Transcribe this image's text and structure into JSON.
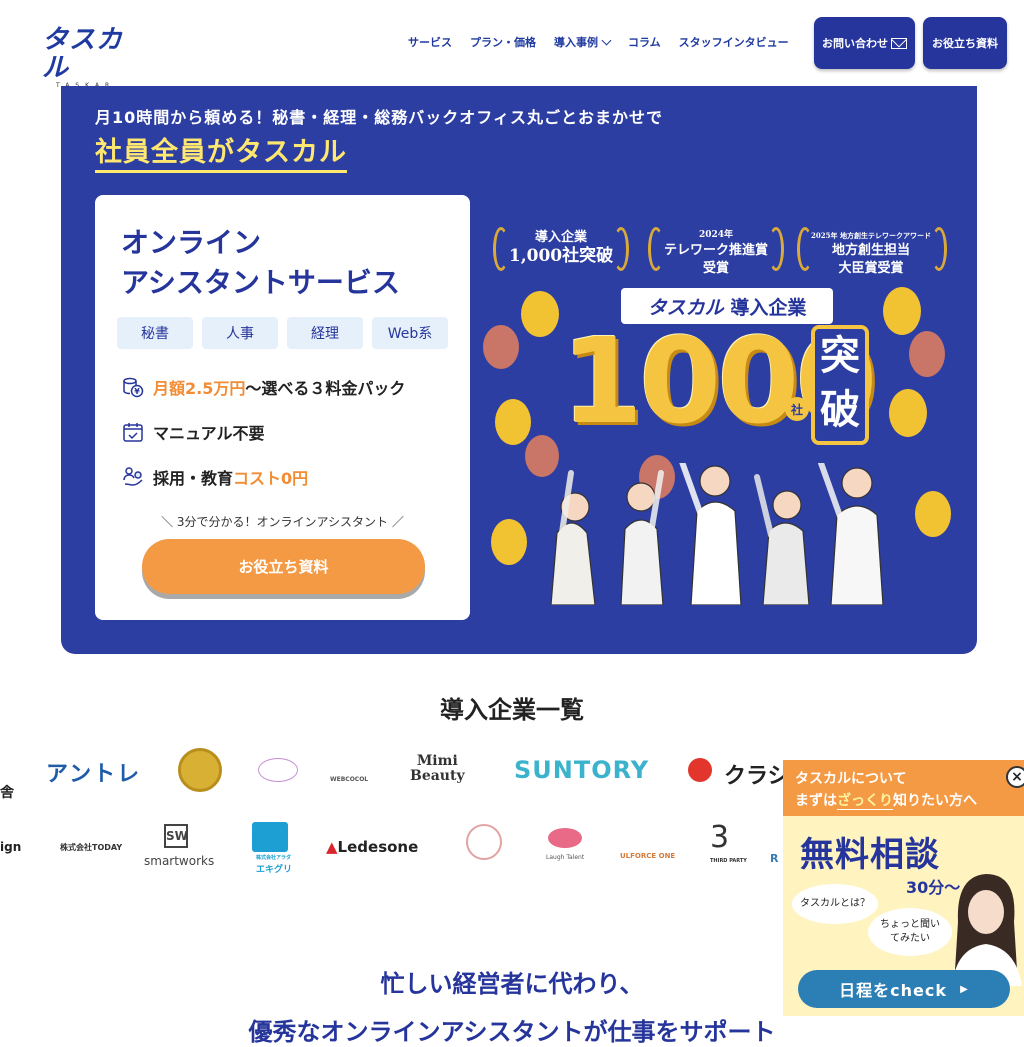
{
  "header": {
    "logo": "タスカル",
    "logo_sub": "TASKAR",
    "nav": [
      "サービス",
      "プラン・価格",
      "導入事例",
      "コラム",
      "スタッフインタビュー"
    ],
    "contact_label": "お問い合わせ",
    "resource_label": "お役立ち資料"
  },
  "hero": {
    "subtitle": "月10時間から頼める！秘書・経理・総務バックオフィス丸ごとおまかせで",
    "headline": "社員全員がタスカル",
    "card": {
      "title_line1": "オンライン",
      "title_line2": "アシスタントサービス",
      "tags": [
        "秘書",
        "人事",
        "経理",
        "Web系"
      ],
      "feature1_prefix": "月額2.5万円",
      "feature1_suffix": "〜選べる３料金パック",
      "feature2": "マニュアル不要",
      "feature3_prefix": "採用・教育",
      "feature3_suffix": "コスト0円",
      "cta_sub": "3分で分かる！オンラインアシスタント",
      "cta_label": "お役立ち資料"
    },
    "promo": {
      "award1_line1": "導入企業",
      "award1_line2": "1,000社突破",
      "award2_small": "2024年",
      "award2_line1": "テレワーク推進賞",
      "award2_line2": "受賞",
      "award3_small": "2025年 地方創生テレワークアワード",
      "award3_line1": "地方創生担当",
      "award3_line2": "大臣賞受賞",
      "banner_brand": "タスカル",
      "banner_text": "導入企業",
      "number": "1000",
      "unit": "社",
      "badge_line1": "突",
      "badge_line2": "破"
    }
  },
  "clients": {
    "title": "導入企業一覧",
    "row1": [
      "舎",
      "アントレ",
      "WEBCOCOL",
      "Mimi",
      "Beauty",
      "SUNTORY",
      "クラシ"
    ],
    "row2": [
      "ign",
      "株式会社TODAY",
      "SW",
      "smartworks",
      "株式会社アラダ",
      "エキグリ",
      "Ledesone",
      "Laugh Talent",
      "ULFORCE ONE",
      "THIRD PARTY",
      "R"
    ]
  },
  "float": {
    "head_line1": "タスカルについて",
    "head_line2_prefix": "まずは",
    "head_line2_em": "ざっくり",
    "head_line2_suffix": "知りたい方へ",
    "close": "×",
    "title": "無料相談",
    "minutes": "30分〜",
    "bubble1": "タスカルとは？",
    "bubble2": "ちょっと聞いてみたい",
    "button_label": "日程をcheck"
  },
  "section": {
    "line1": "忙しい経営者に代わり、",
    "line2": "優秀なオンラインアシスタントが仕事をサポート"
  },
  "colors": {
    "brand_blue": "#2c3ea2",
    "accent_orange": "#f49a45",
    "headline_yellow": "#ffe770"
  }
}
